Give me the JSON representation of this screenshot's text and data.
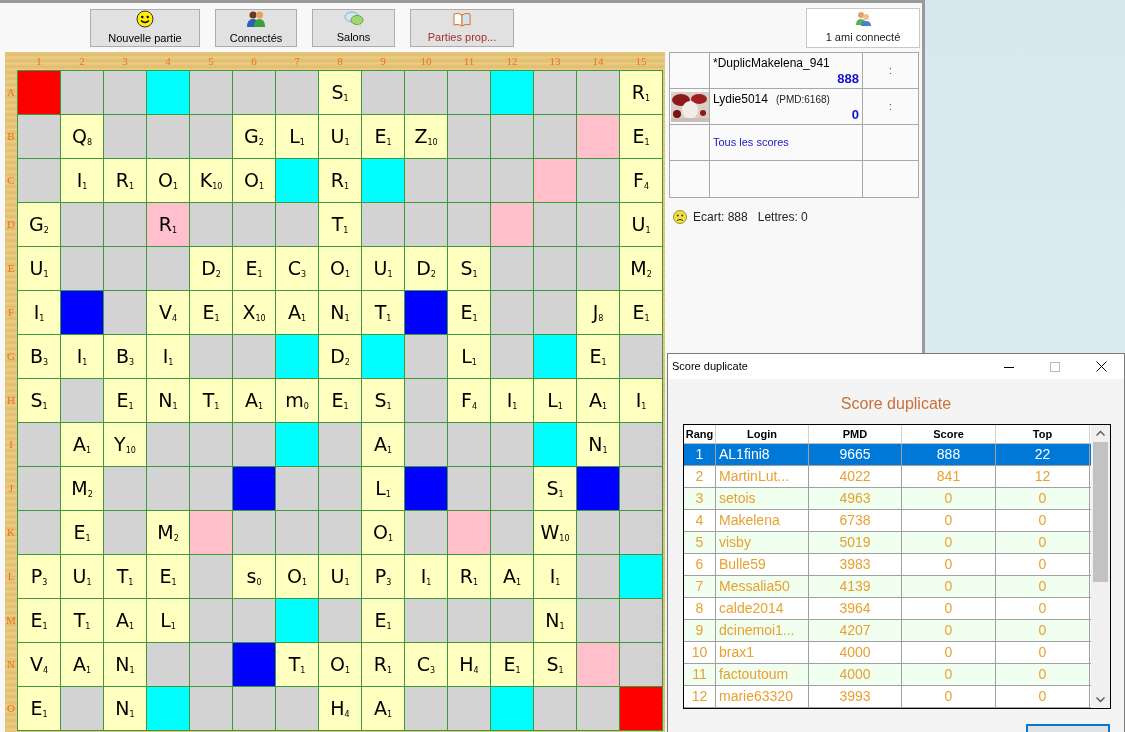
{
  "toolbar": {
    "buttons": [
      {
        "label": "Nouvelle partie",
        "highlighted": false
      },
      {
        "label": "Connectés",
        "highlighted": false
      },
      {
        "label": "Salons",
        "highlighted": false
      },
      {
        "label": "Parties prop...",
        "highlighted": true
      }
    ],
    "friends": "1 ami connecté"
  },
  "board": {
    "column_labels": [
      "1",
      "2",
      "3",
      "4",
      "5",
      "6",
      "7",
      "8",
      "9",
      "10",
      "11",
      "12",
      "13",
      "14",
      "15"
    ],
    "rows": [
      {
        "label": "A",
        "cells": [
          {
            "color": "#ff0000"
          },
          {
            "color": "#d3d3d3"
          },
          {
            "color": "#d3d3d3"
          },
          {
            "color": "#00ffff"
          },
          {
            "color": "#d3d3d3"
          },
          {
            "color": "#d3d3d3"
          },
          {
            "color": "#d3d3d3"
          },
          {
            "letter": "S",
            "points": "1"
          },
          {
            "color": "#d3d3d3"
          },
          {
            "color": "#d3d3d3"
          },
          {
            "color": "#d3d3d3"
          },
          {
            "color": "#00ffff"
          },
          {
            "color": "#d3d3d3"
          },
          {
            "color": "#d3d3d3"
          },
          {
            "letter": "R",
            "points": "1"
          }
        ]
      },
      {
        "label": "B",
        "cells": [
          {
            "color": "#d3d3d3"
          },
          {
            "letter": "Q",
            "points": "8"
          },
          {
            "color": "#d3d3d3"
          },
          {
            "color": "#d3d3d3"
          },
          {
            "color": "#d3d3d3"
          },
          {
            "letter": "G",
            "points": "2"
          },
          {
            "letter": "L",
            "points": "1"
          },
          {
            "letter": "U",
            "points": "1"
          },
          {
            "letter": "E",
            "points": "1"
          },
          {
            "letter": "Z",
            "points": "10"
          },
          {
            "color": "#d3d3d3"
          },
          {
            "color": "#d3d3d3"
          },
          {
            "color": "#d3d3d3"
          },
          {
            "color": "#ffc0cb"
          },
          {
            "letter": "E",
            "points": "1"
          }
        ]
      },
      {
        "label": "C",
        "cells": [
          {
            "color": "#d3d3d3"
          },
          {
            "letter": "I",
            "points": "1"
          },
          {
            "letter": "R",
            "points": "1"
          },
          {
            "letter": "O",
            "points": "1"
          },
          {
            "letter": "K",
            "points": "10"
          },
          {
            "letter": "O",
            "points": "1"
          },
          {
            "color": "#00ffff"
          },
          {
            "letter": "R",
            "points": "1"
          },
          {
            "color": "#00ffff"
          },
          {
            "color": "#d3d3d3"
          },
          {
            "color": "#d3d3d3"
          },
          {
            "color": "#d3d3d3"
          },
          {
            "color": "#ffc0cb"
          },
          {
            "color": "#d3d3d3"
          },
          {
            "letter": "F",
            "points": "4"
          }
        ]
      },
      {
        "label": "D",
        "cells": [
          {
            "letter": "G",
            "points": "2"
          },
          {
            "color": "#d3d3d3"
          },
          {
            "color": "#d3d3d3"
          },
          {
            "letter": "R",
            "points": "1",
            "color": "#ffc0cb"
          },
          {
            "color": "#d3d3d3"
          },
          {
            "color": "#d3d3d3"
          },
          {
            "color": "#d3d3d3"
          },
          {
            "letter": "T",
            "points": "1"
          },
          {
            "color": "#d3d3d3"
          },
          {
            "color": "#d3d3d3"
          },
          {
            "color": "#d3d3d3"
          },
          {
            "color": "#ffc0cb"
          },
          {
            "color": "#d3d3d3"
          },
          {
            "color": "#d3d3d3"
          },
          {
            "letter": "U",
            "points": "1"
          }
        ]
      },
      {
        "label": "E",
        "cells": [
          {
            "letter": "U",
            "points": "1"
          },
          {
            "color": "#d3d3d3"
          },
          {
            "color": "#d3d3d3"
          },
          {
            "color": "#d3d3d3"
          },
          {
            "letter": "D",
            "points": "2"
          },
          {
            "letter": "E",
            "points": "1"
          },
          {
            "letter": "C",
            "points": "3"
          },
          {
            "letter": "O",
            "points": "1"
          },
          {
            "letter": "U",
            "points": "1"
          },
          {
            "letter": "D",
            "points": "2"
          },
          {
            "letter": "S",
            "points": "1"
          },
          {
            "color": "#d3d3d3"
          },
          {
            "color": "#d3d3d3"
          },
          {
            "color": "#d3d3d3"
          },
          {
            "letter": "M",
            "points": "2"
          }
        ]
      },
      {
        "label": "F",
        "cells": [
          {
            "letter": "I",
            "points": "1"
          },
          {
            "color": "#0000ff"
          },
          {
            "color": "#d3d3d3"
          },
          {
            "letter": "V",
            "points": "4"
          },
          {
            "letter": "E",
            "points": "1"
          },
          {
            "letter": "X",
            "points": "10"
          },
          {
            "letter": "A",
            "points": "1"
          },
          {
            "letter": "N",
            "points": "1"
          },
          {
            "letter": "T",
            "points": "1"
          },
          {
            "color": "#0000ff"
          },
          {
            "letter": "E",
            "points": "1"
          },
          {
            "color": "#d3d3d3"
          },
          {
            "color": "#d3d3d3"
          },
          {
            "letter": "J",
            "points": "8"
          },
          {
            "letter": "E",
            "points": "1"
          }
        ]
      },
      {
        "label": "G",
        "cells": [
          {
            "letter": "B",
            "points": "3"
          },
          {
            "letter": "I",
            "points": "1"
          },
          {
            "letter": "B",
            "points": "3"
          },
          {
            "letter": "I",
            "points": "1"
          },
          {
            "color": "#d3d3d3"
          },
          {
            "color": "#d3d3d3"
          },
          {
            "color": "#00ffff"
          },
          {
            "letter": "D",
            "points": "2"
          },
          {
            "color": "#00ffff"
          },
          {
            "color": "#d3d3d3"
          },
          {
            "letter": "L",
            "points": "1"
          },
          {
            "color": "#d3d3d3"
          },
          {
            "color": "#00ffff"
          },
          {
            "letter": "E",
            "points": "1"
          },
          {
            "color": "#d3d3d3"
          }
        ]
      },
      {
        "label": "H",
        "cells": [
          {
            "letter": "S",
            "points": "1"
          },
          {
            "color": "#d3d3d3"
          },
          {
            "letter": "E",
            "points": "1"
          },
          {
            "letter": "N",
            "points": "1"
          },
          {
            "letter": "T",
            "points": "1"
          },
          {
            "letter": "A",
            "points": "1"
          },
          {
            "letter": "m",
            "points": "0"
          },
          {
            "letter": "E",
            "points": "1"
          },
          {
            "letter": "S",
            "points": "1"
          },
          {
            "color": "#d3d3d3"
          },
          {
            "letter": "F",
            "points": "4"
          },
          {
            "letter": "I",
            "points": "1"
          },
          {
            "letter": "L",
            "points": "1"
          },
          {
            "letter": "A",
            "points": "1"
          },
          {
            "letter": "I",
            "points": "1"
          }
        ]
      },
      {
        "label": "I",
        "cells": [
          {
            "color": "#d3d3d3"
          },
          {
            "letter": "A",
            "points": "1"
          },
          {
            "letter": "Y",
            "points": "10"
          },
          {
            "color": "#d3d3d3"
          },
          {
            "color": "#d3d3d3"
          },
          {
            "color": "#d3d3d3"
          },
          {
            "color": "#00ffff"
          },
          {
            "color": "#d3d3d3"
          },
          {
            "letter": "A",
            "points": "1"
          },
          {
            "color": "#d3d3d3"
          },
          {
            "color": "#d3d3d3"
          },
          {
            "color": "#d3d3d3"
          },
          {
            "color": "#00ffff"
          },
          {
            "letter": "N",
            "points": "1"
          },
          {
            "color": "#d3d3d3"
          }
        ]
      },
      {
        "label": "J",
        "cells": [
          {
            "color": "#d3d3d3"
          },
          {
            "letter": "M",
            "points": "2"
          },
          {
            "color": "#d3d3d3"
          },
          {
            "color": "#d3d3d3"
          },
          {
            "color": "#d3d3d3"
          },
          {
            "color": "#0000ff"
          },
          {
            "color": "#d3d3d3"
          },
          {
            "color": "#d3d3d3"
          },
          {
            "letter": "L",
            "points": "1"
          },
          {
            "color": "#0000ff"
          },
          {
            "color": "#d3d3d3"
          },
          {
            "color": "#d3d3d3"
          },
          {
            "letter": "S",
            "points": "1"
          },
          {
            "color": "#0000ff"
          },
          {
            "color": "#d3d3d3"
          }
        ]
      },
      {
        "label": "K",
        "cells": [
          {
            "color": "#d3d3d3"
          },
          {
            "letter": "E",
            "points": "1"
          },
          {
            "color": "#d3d3d3"
          },
          {
            "letter": "M",
            "points": "2"
          },
          {
            "color": "#ffc0cb"
          },
          {
            "color": "#d3d3d3"
          },
          {
            "color": "#d3d3d3"
          },
          {
            "color": "#d3d3d3"
          },
          {
            "letter": "O",
            "points": "1"
          },
          {
            "color": "#d3d3d3"
          },
          {
            "color": "#ffc0cb"
          },
          {
            "color": "#d3d3d3"
          },
          {
            "letter": "W",
            "points": "10"
          },
          {
            "color": "#d3d3d3"
          },
          {
            "color": "#d3d3d3"
          }
        ]
      },
      {
        "label": "L",
        "cells": [
          {
            "letter": "P",
            "points": "3"
          },
          {
            "letter": "U",
            "points": "1"
          },
          {
            "letter": "T",
            "points": "1"
          },
          {
            "letter": "E",
            "points": "1"
          },
          {
            "color": "#d3d3d3"
          },
          {
            "letter": "s",
            "points": "0"
          },
          {
            "letter": "O",
            "points": "1"
          },
          {
            "letter": "U",
            "points": "1"
          },
          {
            "letter": "P",
            "points": "3"
          },
          {
            "letter": "I",
            "points": "1"
          },
          {
            "letter": "R",
            "points": "1"
          },
          {
            "letter": "A",
            "points": "1"
          },
          {
            "letter": "I",
            "points": "1"
          },
          {
            "color": "#d3d3d3"
          },
          {
            "color": "#00ffff"
          }
        ]
      },
      {
        "label": "M",
        "cells": [
          {
            "letter": "E",
            "points": "1"
          },
          {
            "letter": "T",
            "points": "1"
          },
          {
            "letter": "A",
            "points": "1"
          },
          {
            "letter": "L",
            "points": "1"
          },
          {
            "color": "#d3d3d3"
          },
          {
            "color": "#d3d3d3"
          },
          {
            "color": "#00ffff"
          },
          {
            "color": "#d3d3d3"
          },
          {
            "letter": "E",
            "points": "1"
          },
          {
            "color": "#d3d3d3"
          },
          {
            "color": "#d3d3d3"
          },
          {
            "color": "#d3d3d3"
          },
          {
            "letter": "N",
            "points": "1"
          },
          {
            "color": "#d3d3d3"
          },
          {
            "color": "#d3d3d3"
          }
        ]
      },
      {
        "label": "N",
        "cells": [
          {
            "letter": "V",
            "points": "4"
          },
          {
            "letter": "A",
            "points": "1"
          },
          {
            "letter": "N",
            "points": "1"
          },
          {
            "color": "#d3d3d3"
          },
          {
            "color": "#d3d3d3"
          },
          {
            "color": "#0000ff"
          },
          {
            "letter": "T",
            "points": "1"
          },
          {
            "letter": "O",
            "points": "1"
          },
          {
            "letter": "R",
            "points": "1"
          },
          {
            "letter": "C",
            "points": "3"
          },
          {
            "letter": "H",
            "points": "4"
          },
          {
            "letter": "E",
            "points": "1"
          },
          {
            "letter": "S",
            "points": "1"
          },
          {
            "color": "#ffc0cb"
          },
          {
            "color": "#d3d3d3"
          }
        ]
      },
      {
        "label": "O",
        "cells": [
          {
            "letter": "E",
            "points": "1"
          },
          {
            "color": "#d3d3d3"
          },
          {
            "letter": "N",
            "points": "1"
          },
          {
            "color": "#00ffff"
          },
          {
            "color": "#d3d3d3"
          },
          {
            "color": "#d3d3d3"
          },
          {
            "color": "#d3d3d3"
          },
          {
            "letter": "H",
            "points": "4"
          },
          {
            "letter": "A",
            "points": "1"
          },
          {
            "color": "#d3d3d3"
          },
          {
            "color": "#d3d3d3"
          },
          {
            "color": "#00ffff"
          },
          {
            "color": "#d3d3d3"
          },
          {
            "color": "#d3d3d3"
          },
          {
            "color": "#ff0000"
          }
        ]
      }
    ]
  },
  "players": [
    {
      "name": "*DuplicMakelena_941",
      "score": "888",
      "column_3": ":"
    },
    {
      "name": "Lydie5014",
      "pmd": "(PMD:6168)",
      "score": "0",
      "column_3": ":"
    }
  ],
  "all_scores_link": "Tous les scores",
  "status": {
    "ecart": "Ecart: 888",
    "lettres": "Lettres: 0"
  },
  "score_dialog": {
    "title": "Score duplicate",
    "heading": "Score duplicate",
    "columns": [
      "Rang",
      "Login",
      "PMD",
      "Score",
      "Top"
    ],
    "rows": [
      {
        "cells": [
          "1",
          "AL1fini8",
          "9665",
          "888",
          "22"
        ],
        "selected": true
      },
      {
        "cells": [
          "2",
          "MartinLut...",
          "4022",
          "841",
          "12"
        ],
        "selected": false
      },
      {
        "cells": [
          "3",
          "setois",
          "4963",
          "0",
          "0"
        ],
        "selected": false
      },
      {
        "cells": [
          "4",
          "Makelena",
          "6738",
          "0",
          "0"
        ],
        "selected": false
      },
      {
        "cells": [
          "5",
          "visby",
          "5019",
          "0",
          "0"
        ],
        "selected": false
      },
      {
        "cells": [
          "6",
          "Bulle59",
          "3983",
          "0",
          "0"
        ],
        "selected": false
      },
      {
        "cells": [
          "7",
          "Messalia50",
          "4139",
          "0",
          "0"
        ],
        "selected": false
      },
      {
        "cells": [
          "8",
          "calde2014",
          "3964",
          "0",
          "0"
        ],
        "selected": false
      },
      {
        "cells": [
          "9",
          "dcinemoi1...",
          "4207",
          "0",
          "0"
        ],
        "selected": false
      },
      {
        "cells": [
          "10",
          "brax1",
          "4000",
          "0",
          "0"
        ],
        "selected": false
      },
      {
        "cells": [
          "11",
          "factoutoum",
          "4000",
          "0",
          "0"
        ],
        "selected": false
      },
      {
        "cells": [
          "12",
          "marie63320",
          "3993",
          "0",
          "0"
        ],
        "selected": false
      }
    ]
  }
}
